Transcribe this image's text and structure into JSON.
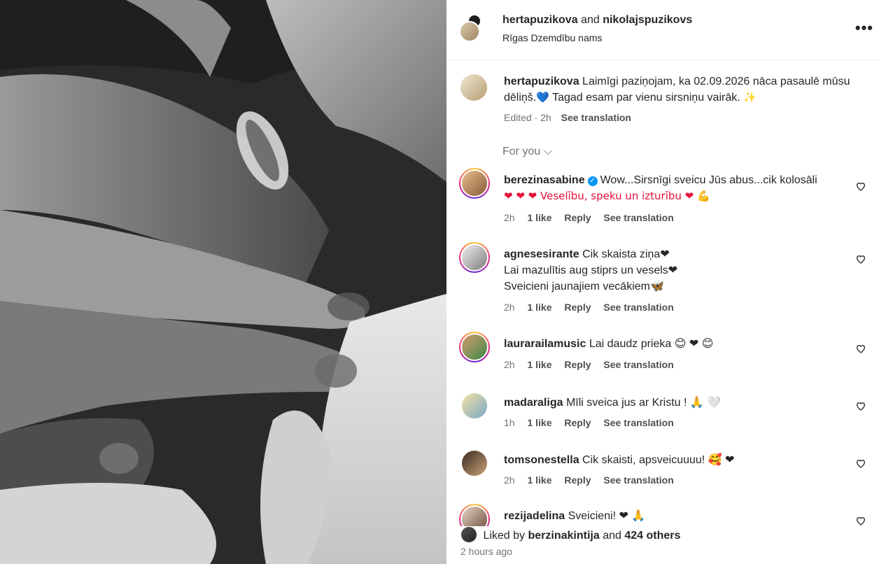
{
  "header": {
    "user1": "hertapuzikova",
    "and": "and",
    "user2": "nikolajspuzikovs",
    "location": "Rīgas Dzemdību nams",
    "more": "•••"
  },
  "caption": {
    "username": "hertapuzikova",
    "text": "Laimīgi paziņojam, ka 02.09.2026 nāca pasaulē mūsu dēliņš.",
    "text2": " Tagad esam par vienu sirsniņu vairāk. ",
    "emoji1": "💙",
    "emoji2": "✨",
    "meta": "Edited · 2h",
    "see_translation": "See translation"
  },
  "for_you": "For you ⌵",
  "comments": [
    {
      "username": "berezinasabine",
      "verified": true,
      "line1": "Wow...Sirsnīgi sveicu Jūs abus...cik kolosāli",
      "line2": "❤ ❤ ❤  Veselību, speku un izturību ❤ 💪",
      "time": "2h",
      "likes": "1 like",
      "reply": "Reply",
      "see_translation": "See translation"
    },
    {
      "username": "agnesesirante",
      "line1": "Cik skaista ziņa❤",
      "line2": "Lai mazulītis aug stiprs un vesels❤",
      "line3": "Sveicieni jaunajiem vecākiem🦋",
      "time": "2h",
      "likes": "1 like",
      "reply": "Reply",
      "see_translation": "See translation"
    },
    {
      "username": "laurarailamusic",
      "line1": "Lai daudz prieka 😊 ❤ 😊",
      "time": "2h",
      "likes": "1 like",
      "reply": "Reply",
      "see_translation": "See translation"
    },
    {
      "username": "madaraliga",
      "line1": "Mīli sveica jus ar Kristu ! 🙏 🤍",
      "time": "1h",
      "likes": "1 like",
      "reply": "Reply",
      "see_translation": "See translation"
    },
    {
      "username": "tomsonestella",
      "line1": "Cik skaisti, apsveicuuuu! 🥰 ❤",
      "time": "2h",
      "likes": "1 like",
      "reply": "Reply",
      "see_translation": "See translation"
    },
    {
      "username": "rezijadelina",
      "line1": "Sveicieni! ❤ 🙏"
    }
  ],
  "liked_by": {
    "prefix": "Liked by",
    "user": "berzinakintija",
    "and": "and",
    "others": "424 others"
  },
  "time_ago": "2 hours ago"
}
